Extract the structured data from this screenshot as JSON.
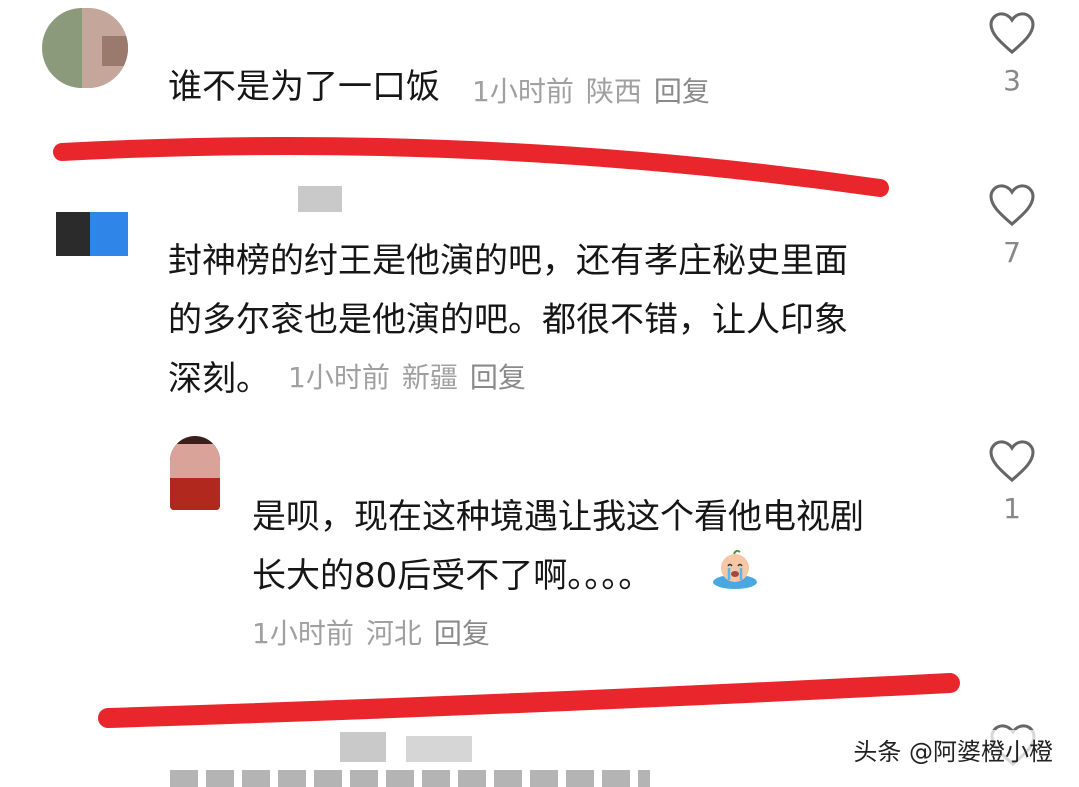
{
  "comments": [
    {
      "text": "谁不是为了一口饭",
      "time": "1小时前",
      "location": "陕西",
      "reply_label": "回复",
      "likes": "3"
    },
    {
      "text": "封神榜的纣王是他演的吧，还有孝庄秘史里面\n的多尔衮也是他演的吧。都很不错，让人印象\n深刻。",
      "time": "1小时前",
      "location": "新疆",
      "reply_label": "回复",
      "likes": "7"
    },
    {
      "text": "是呗，现在这种境遇让我这个看他电视剧\n长大的80后受不了啊。。。。",
      "time": "1小时前",
      "location": "河北",
      "reply_label": "回复",
      "likes": "1"
    }
  ],
  "watermark": "头条 @阿婆橙小橙",
  "colors": {
    "red_mark": "#e8262b",
    "meta": "#a0a0a0",
    "icon": "#888888"
  }
}
